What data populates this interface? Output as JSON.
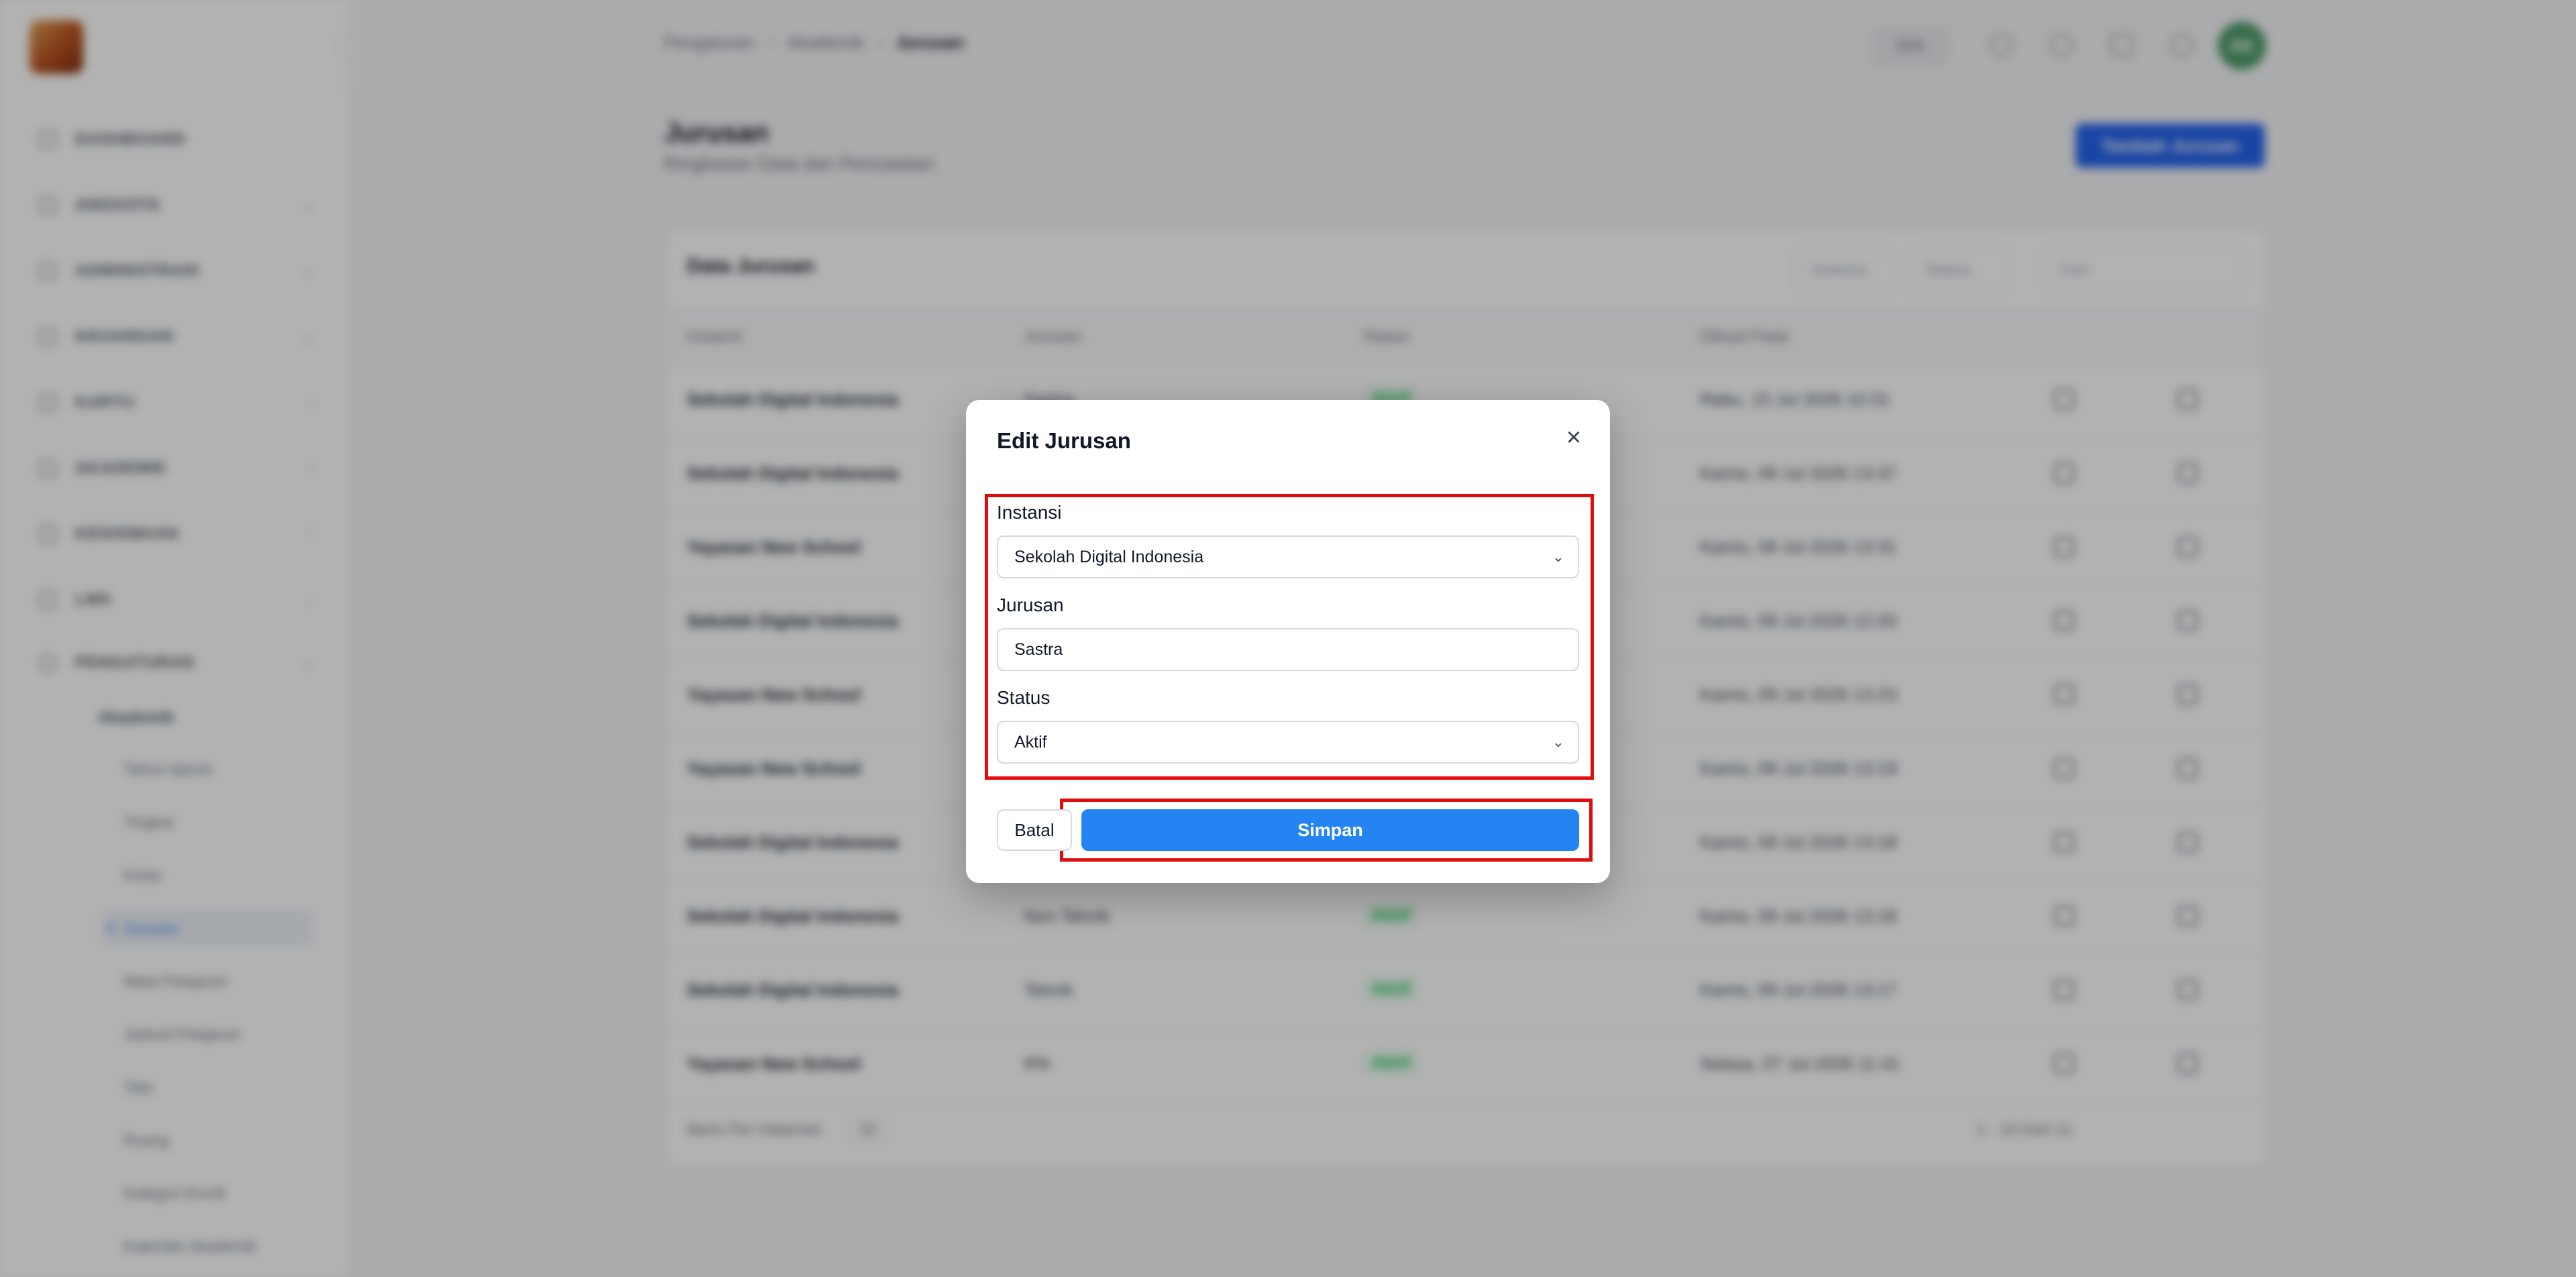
{
  "sidebar": {
    "items": [
      {
        "label": "DASHBOARD"
      },
      {
        "label": "ANGGOTA"
      },
      {
        "label": "ADMINISTRASI"
      },
      {
        "label": "KEUANGAN"
      },
      {
        "label": "KARTU"
      },
      {
        "label": "AKADEMIK"
      },
      {
        "label": "KESISWAAN"
      },
      {
        "label": "LMS"
      },
      {
        "label": "PENGATURAN"
      }
    ],
    "sub_group": "Akademik",
    "sub_items": [
      {
        "label": "Tahun Ajaran"
      },
      {
        "label": "Tingkat"
      },
      {
        "label": "Kelas"
      },
      {
        "label": "Jurusan"
      },
      {
        "label": "Mata Pelajaran"
      },
      {
        "label": "Jadwal Pelajaran"
      },
      {
        "label": "Tata"
      },
      {
        "label": "Ruang"
      },
      {
        "label": "Kategori Enroll"
      },
      {
        "label": "Kalender Akademik"
      }
    ]
  },
  "header": {
    "breadcrumb": [
      "Pengaturan",
      "Akademik",
      "Jurusan"
    ],
    "lang": "IDN",
    "avatar": "AK"
  },
  "page": {
    "title": "Jurusan",
    "subtitle": "Ringkasan Data dan Pencatatan",
    "add_button": "Tambah Jurusan"
  },
  "table": {
    "title": "Data Jurusan",
    "filters": {
      "instansi": "Instansi",
      "status": "Status",
      "search": "Cari"
    },
    "columns": [
      "Instansi",
      "Jurusan",
      "Status",
      "Dibuat Pada"
    ],
    "rows": [
      {
        "instansi": "Sekolah Digital Indonesia",
        "jurusan": "Sastra",
        "status": "Aktif",
        "dibuat": "Rabu, 15 Jul 2026 10:31"
      },
      {
        "instansi": "Sekolah Digital Indonesia",
        "jurusan": "",
        "status": "",
        "dibuat": "Kamis, 09 Jul 2026 13:37"
      },
      {
        "instansi": "Yayasan New School",
        "jurusan": "",
        "status": "",
        "dibuat": "Kamis, 09 Jul 2026 13:31"
      },
      {
        "instansi": "Sekolah Digital Indonesia",
        "jurusan": "",
        "status": "",
        "dibuat": "Kamis, 09 Jul 2026 12:20"
      },
      {
        "instansi": "Yayasan New School",
        "jurusan": "",
        "status": "",
        "dibuat": "Kamis, 09 Jul 2026 13:23"
      },
      {
        "instansi": "Yayasan New School",
        "jurusan": "",
        "status": "",
        "dibuat": "Kamis, 09 Jul 2026 13:19"
      },
      {
        "instansi": "Sekolah Digital Indonesia",
        "jurusan": "",
        "status": "",
        "dibuat": "Kamis, 09 Jul 2026 13:18"
      },
      {
        "instansi": "Sekolah Digital Indonesia",
        "jurusan": "Non Teknik",
        "status": "Aktif",
        "dibuat": "Kamis, 09 Jul 2026 13:18"
      },
      {
        "instansi": "Sekolah Digital Indonesia",
        "jurusan": "Teknik",
        "status": "Aktif",
        "dibuat": "Kamis, 09 Jul 2026 13:17"
      },
      {
        "instansi": "Yayasan New School",
        "jurusan": "IPA",
        "status": "Aktif",
        "dibuat": "Selasa, 07 Jul 2026 11:41"
      }
    ],
    "footer_left": "Baris Per Halaman",
    "page_size": "10",
    "footer_right": "1 - 10 Dari 11"
  },
  "modal": {
    "title": "Edit Jurusan",
    "instansi_label": "Instansi",
    "instansi_value": "Sekolah Digital Indonesia",
    "jurusan_label": "Jurusan",
    "jurusan_value": "Sastra",
    "status_label": "Status",
    "status_value": "Aktif",
    "cancel_label": "Batal",
    "save_label": "Simpan"
  },
  "colors": {
    "primary": "#2384f2",
    "highlight": "#e10d0d",
    "status_active": "#22c55e"
  }
}
